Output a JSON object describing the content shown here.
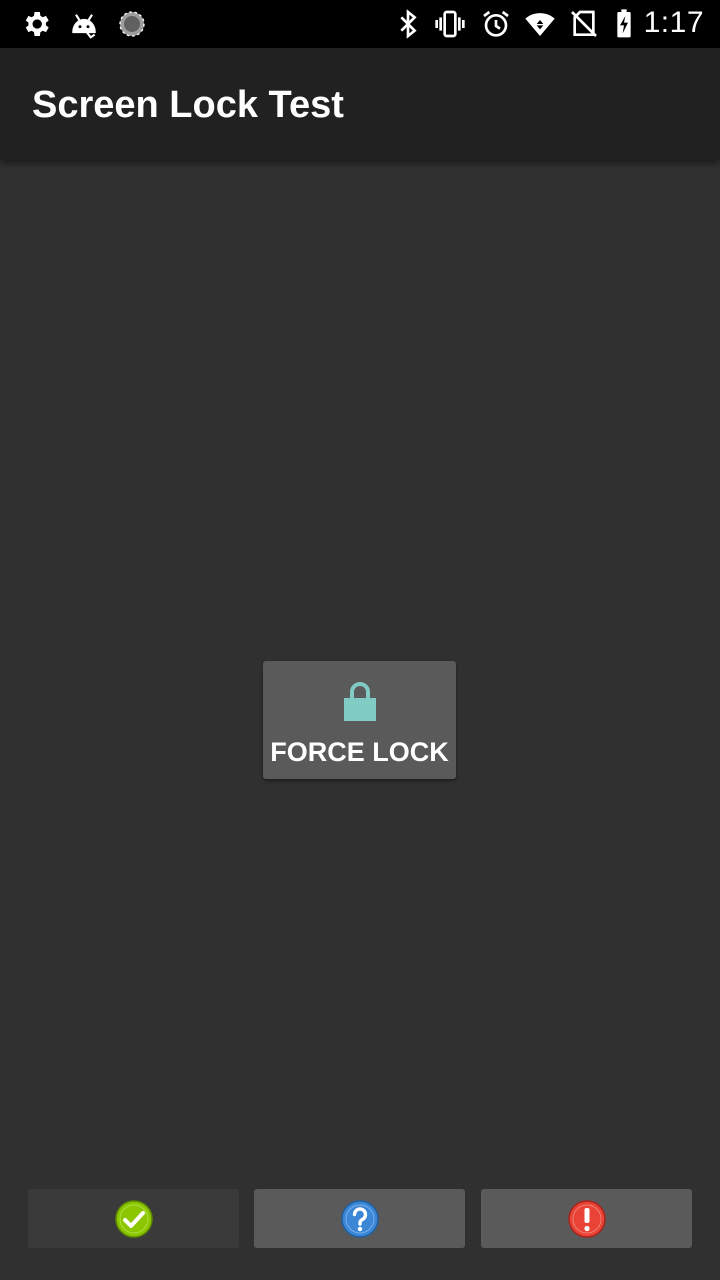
{
  "status_bar": {
    "time": "1:17",
    "left_icons": [
      "gear-icon",
      "android-debug-icon",
      "sync-circle-icon"
    ],
    "right_icons": [
      "bluetooth-icon",
      "vibrate-icon",
      "alarm-icon",
      "wifi-icon",
      "no-sim-icon",
      "battery-charging-icon"
    ]
  },
  "app_bar": {
    "title": "Screen Lock Test"
  },
  "main": {
    "force_lock_label": "FORCE LOCK",
    "lock_icon": "lock-icon",
    "lock_icon_color": "#80cbc4"
  },
  "bottom_bar": {
    "buttons": [
      {
        "name": "pass",
        "icon": "check-circle-icon",
        "color": "#8bc600",
        "bg": "#3a3a3b"
      },
      {
        "name": "info",
        "icon": "question-circle-icon",
        "color": "#3b87d6",
        "bg": "#5a5a5b"
      },
      {
        "name": "fail",
        "icon": "alert-circle-icon",
        "color": "#e84335",
        "bg": "#5a5a5b"
      }
    ]
  }
}
